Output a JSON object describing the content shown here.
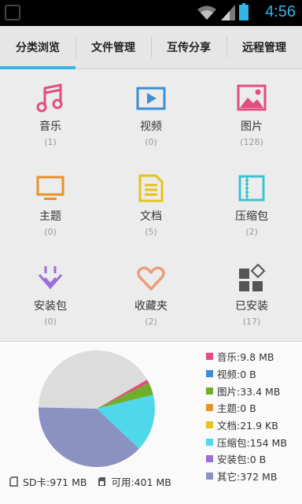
{
  "status_bar": {
    "time": "4:56",
    "icons": [
      "wifi-icon",
      "cell-signal-icon",
      "battery-icon"
    ]
  },
  "tabs": [
    {
      "label": "分类浏览",
      "active": true
    },
    {
      "label": "文件管理",
      "active": false
    },
    {
      "label": "互传分享",
      "active": false
    },
    {
      "label": "远程管理",
      "active": false
    }
  ],
  "categories": [
    {
      "name": "音乐",
      "count": "(1)",
      "icon": "music-note-icon",
      "color": "#e24c7e"
    },
    {
      "name": "视频",
      "count": "(0)",
      "icon": "video-icon",
      "color": "#3c8fd6"
    },
    {
      "name": "图片",
      "count": "(128)",
      "icon": "picture-icon",
      "color": "#e24c7e"
    },
    {
      "name": "主题",
      "count": "(0)",
      "icon": "monitor-icon",
      "color": "#e8922a"
    },
    {
      "name": "文档",
      "count": "(5)",
      "icon": "document-icon",
      "color": "#e6c21c"
    },
    {
      "name": "压缩包",
      "count": "(2)",
      "icon": "zip-archive-icon",
      "color": "#3cc3cf"
    },
    {
      "name": "安装包",
      "count": "(0)",
      "icon": "install-arrow-icon",
      "color": "#9a6fd9"
    },
    {
      "name": "收藏夹",
      "count": "(2)",
      "icon": "heart-icon",
      "color": "#e8a07a"
    },
    {
      "name": "已安装",
      "count": "(17)",
      "icon": "apps-grid-icon",
      "color": "#555555"
    }
  ],
  "storage": {
    "legend": [
      {
        "label": "音乐:9.8 MB",
        "color": "#e24c7e"
      },
      {
        "label": "视频:0 B",
        "color": "#3c8fd6"
      },
      {
        "label": "图片:33.4 MB",
        "color": "#6fae2a"
      },
      {
        "label": "主题:0 B",
        "color": "#e8922a"
      },
      {
        "label": "文档:21.9 KB",
        "color": "#e6c21c"
      },
      {
        "label": "压缩包:154 MB",
        "color": "#4fd8ea"
      },
      {
        "label": "安装包:0 B",
        "color": "#9a6fd9"
      },
      {
        "label": "其它:372 MB",
        "color": "#8a92c2"
      }
    ],
    "pie_free_color": "#dcdcdc",
    "sd_label": "SD卡:971 MB",
    "free_label": "可用:401 MB"
  },
  "chart_data": {
    "type": "pie",
    "labels": [
      "音乐",
      "视频",
      "图片",
      "主题",
      "文档",
      "压缩包",
      "安装包",
      "其它",
      "可用"
    ],
    "values_mb": [
      9.8,
      0,
      33.4,
      0,
      0.0214,
      154,
      0,
      372,
      401
    ],
    "total_mb": 971
  }
}
